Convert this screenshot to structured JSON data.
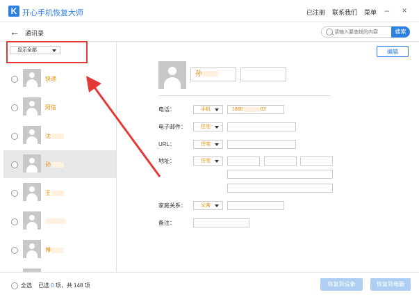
{
  "app": {
    "logo_letter": "K",
    "title": "开心手机恢复大师",
    "registered": "已注册",
    "contact_us": "联系我们",
    "menu": "菜单"
  },
  "nav": {
    "title": "通讯录"
  },
  "search": {
    "placeholder": "请输入要查找的内容",
    "button": "搜索"
  },
  "filter": {
    "selected": "显示全部"
  },
  "contacts": [
    {
      "name": "快递"
    },
    {
      "name": "阿信"
    },
    {
      "name": "沈"
    },
    {
      "name": "孙"
    },
    {
      "name": "王"
    },
    {
      "name": ""
    },
    {
      "name": "博"
    }
  ],
  "detail": {
    "edit_button": "编辑",
    "first_name": "孙",
    "labels": {
      "phone": "电话：",
      "email": "电子邮件：",
      "url": "URL：",
      "address": "地址：",
      "family": "家庭关系：",
      "note": "备注："
    },
    "phone_type": "手机",
    "phone_value_start": "1866",
    "phone_value_end": "03",
    "email_type": "住宅",
    "url_type": "住宅",
    "address_type": "住宅",
    "family_type": "父亲"
  },
  "footer": {
    "select_all": "全选",
    "selected_prefix": "已选",
    "selected_count": "0",
    "selected_mid": "项，共",
    "total_count": "148",
    "selected_suffix": "项",
    "restore_device": "恢复到设备",
    "restore_pc": "恢复到电脑"
  },
  "colors": {
    "accent": "#2d7fe0",
    "name_text": "#e68a00",
    "annotation": "#e53935"
  }
}
